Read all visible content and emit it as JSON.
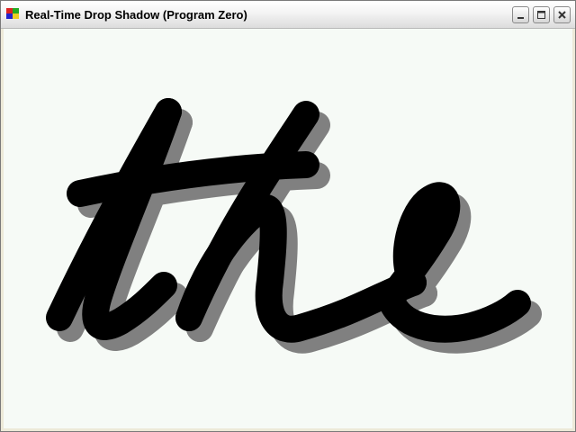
{
  "window": {
    "title": "Real-Time Drop Shadow (Program Zero)",
    "icon": "app-window-icon",
    "buttons": [
      "minimize-icon",
      "maximize-icon",
      "close-icon"
    ]
  },
  "canvas": {
    "background": "#f6faf6",
    "stroke_color": "#000000",
    "shadow_color": "#808080",
    "content": "handwritten word drawn as thick black strokes with gray drop shadow"
  }
}
